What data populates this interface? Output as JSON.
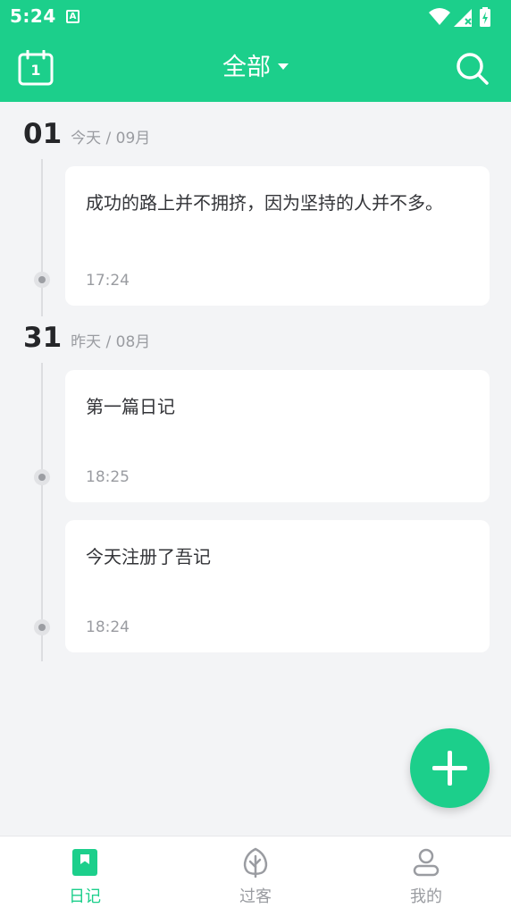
{
  "status_bar": {
    "time": "5:24",
    "app_icon_letter": "A"
  },
  "app_bar": {
    "title": "全部",
    "calendar_day": "1"
  },
  "groups": [
    {
      "day": "01",
      "sub": "今天 / 09月",
      "entries": [
        {
          "text": "成功的路上并不拥挤，因为坚持的人并不多。",
          "time": "17:24"
        }
      ]
    },
    {
      "day": "31",
      "sub": "昨天 / 08月",
      "entries": [
        {
          "text": "第一篇日记",
          "time": "18:25"
        },
        {
          "text": "今天注册了吾记",
          "time": "18:24"
        }
      ]
    }
  ],
  "bottom_nav": [
    {
      "label": "日记",
      "icon": "bookmark-icon",
      "active": true
    },
    {
      "label": "过客",
      "icon": "leaf-icon",
      "active": false
    },
    {
      "label": "我的",
      "icon": "person-icon",
      "active": false
    }
  ],
  "colors": {
    "accent": "#1ccf8b",
    "inactive": "#9a9ca1"
  }
}
